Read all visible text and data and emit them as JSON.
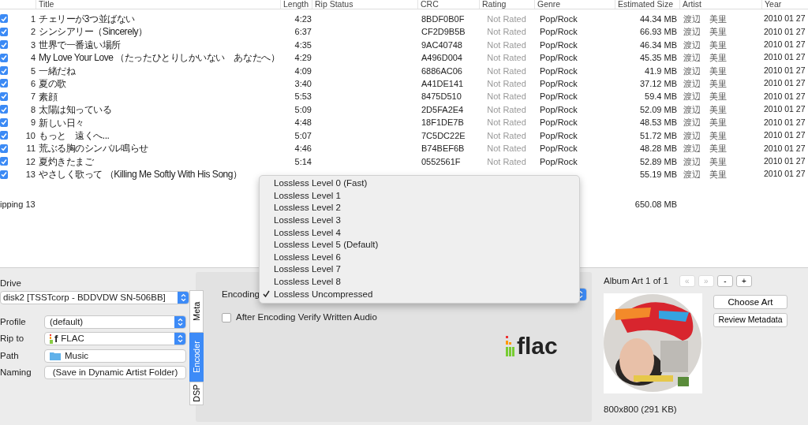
{
  "table": {
    "columns": [
      "Title",
      "Length",
      "Rip Status",
      "CRC",
      "Rating",
      "Genre",
      "Estimated Size",
      "Artist",
      "Year"
    ],
    "rows": [
      {
        "checked": true,
        "number": "1",
        "title": "チェリーが3つ並ばない",
        "length": "4:23",
        "crc": "8BDF0B0F",
        "rating": "Not Rated",
        "genre": "Pop/Rock",
        "size": "44.34 MB",
        "artist": "渡辺　美里",
        "year": "2010 01 27"
      },
      {
        "checked": true,
        "number": "2",
        "title": "シンシアリー（Sincerely）",
        "length": "6:37",
        "crc": "CF2D9B5B",
        "rating": "Not Rated",
        "genre": "Pop/Rock",
        "size": "66.93 MB",
        "artist": "渡辺　美里",
        "year": "2010 01 27"
      },
      {
        "checked": true,
        "number": "3",
        "title": "世界で一番遠い場所",
        "length": "4:35",
        "crc": "9AC40748",
        "rating": "Not Rated",
        "genre": "Pop/Rock",
        "size": "46.34 MB",
        "artist": "渡辺　美里",
        "year": "2010 01 27"
      },
      {
        "checked": true,
        "number": "4",
        "title": "My Love Your Love （たったひとりしかいない　あなたへ）",
        "length": "4:29",
        "crc": "A496D004",
        "rating": "Not Rated",
        "genre": "Pop/Rock",
        "size": "45.35 MB",
        "artist": "渡辺　美里",
        "year": "2010 01 27"
      },
      {
        "checked": true,
        "number": "5",
        "title": "一緒だね",
        "length": "4:09",
        "crc": "6886AC06",
        "rating": "Not Rated",
        "genre": "Pop/Rock",
        "size": "41.9 MB",
        "artist": "渡辺　美里",
        "year": "2010 01 27"
      },
      {
        "checked": true,
        "number": "6",
        "title": "夏の歌",
        "length": "3:40",
        "crc": "A41DE141",
        "rating": "Not Rated",
        "genre": "Pop/Rock",
        "size": "37.12 MB",
        "artist": "渡辺　美里",
        "year": "2010 01 27"
      },
      {
        "checked": true,
        "number": "7",
        "title": "素顔",
        "length": "5:53",
        "crc": "8475D510",
        "rating": "Not Rated",
        "genre": "Pop/Rock",
        "size": "59.4 MB",
        "artist": "渡辺　美里",
        "year": "2010 01 27"
      },
      {
        "checked": true,
        "number": "8",
        "title": "太陽は知っている",
        "length": "5:09",
        "crc": "2D5FA2E4",
        "rating": "Not Rated",
        "genre": "Pop/Rock",
        "size": "52.09 MB",
        "artist": "渡辺　美里",
        "year": "2010 01 27"
      },
      {
        "checked": true,
        "number": "9",
        "title": "新しい日々",
        "length": "4:48",
        "crc": "18F1DE7B",
        "rating": "Not Rated",
        "genre": "Pop/Rock",
        "size": "48.53 MB",
        "artist": "渡辺　美里",
        "year": "2010 01 27"
      },
      {
        "checked": true,
        "number": "10",
        "title": "もっと　遠くへ...",
        "length": "5:07",
        "crc": "7C5DC22E",
        "rating": "Not Rated",
        "genre": "Pop/Rock",
        "size": "51.72 MB",
        "artist": "渡辺　美里",
        "year": "2010 01 27"
      },
      {
        "checked": true,
        "number": "11",
        "title": "荒ぶる胸のシンバル鳴らせ",
        "length": "4:46",
        "crc": "B74BEF6B",
        "rating": "Not Rated",
        "genre": "Pop/Rock",
        "size": "48.28 MB",
        "artist": "渡辺　美里",
        "year": "2010 01 27"
      },
      {
        "checked": true,
        "number": "12",
        "title": "夏灼きたまご",
        "length": "5:14",
        "crc": "0552561F",
        "rating": "Not Rated",
        "genre": "Pop/Rock",
        "size": "52.89 MB",
        "artist": "渡辺　美里",
        "year": "2010 01 27"
      },
      {
        "checked": true,
        "number": "13",
        "title": "やさしく歌って （Killing Me Softly With His Song）",
        "size": "55.19 MB",
        "artist": "渡辺　美里",
        "year": "2010 01 27"
      }
    ],
    "footer_status": "ipping 13",
    "footer_size": "650.08 MB"
  },
  "left_panel": {
    "drive_label": "Drive",
    "drive": "disk2  [TSSTcorp - BDDVDW SN-506BB]",
    "fields": [
      {
        "label": "Profile",
        "kind": "select",
        "value": "(default)"
      },
      {
        "label": "Rip to",
        "kind": "select",
        "icon_text": "f",
        "value": "FLAC"
      },
      {
        "label": "Path",
        "kind": "folder",
        "value": "Music"
      },
      {
        "label": "Naming",
        "kind": "button",
        "value": "(Save in Dynamic Artist Folder)"
      }
    ]
  },
  "tabs": [
    {
      "label": "Meta",
      "selected": false
    },
    {
      "label": "Encoder",
      "selected": true
    },
    {
      "label": "DSP",
      "selected": false
    }
  ],
  "encoder": {
    "encoding_label": "Encoding",
    "verify": {
      "label": "After Encoding Verify Written Audio",
      "checked": false
    },
    "logo_text": "flac"
  },
  "encoding_menu": [
    {
      "label": "Lossless Level 0 (Fast)",
      "selected": false
    },
    {
      "label": "Lossless Level 1",
      "selected": false
    },
    {
      "label": "Lossless Level 2",
      "selected": false
    },
    {
      "label": "Lossless Level 3",
      "selected": false
    },
    {
      "label": "Lossless Level 4",
      "selected": false
    },
    {
      "label": "Lossless Level 5 (Default)",
      "selected": false
    },
    {
      "label": "Lossless Level 6",
      "selected": false
    },
    {
      "label": "Lossless Level 7",
      "selected": false
    },
    {
      "label": "Lossless Level 8",
      "selected": false
    },
    {
      "label": "Lossless Uncompressed",
      "selected": true
    }
  ],
  "album_art": {
    "title": "Album Art 1 of 1",
    "nav_buttons": [
      {
        "label": "«",
        "disabled": true
      },
      {
        "label": "»",
        "disabled": true
      },
      {
        "label": "-",
        "disabled": false
      },
      {
        "label": "+",
        "disabled": false
      }
    ],
    "image": {
      "kind": "picture"
    },
    "buttons": [
      "Choose Art",
      "Review Metadata"
    ],
    "info": "800x800 (291 KB)"
  }
}
